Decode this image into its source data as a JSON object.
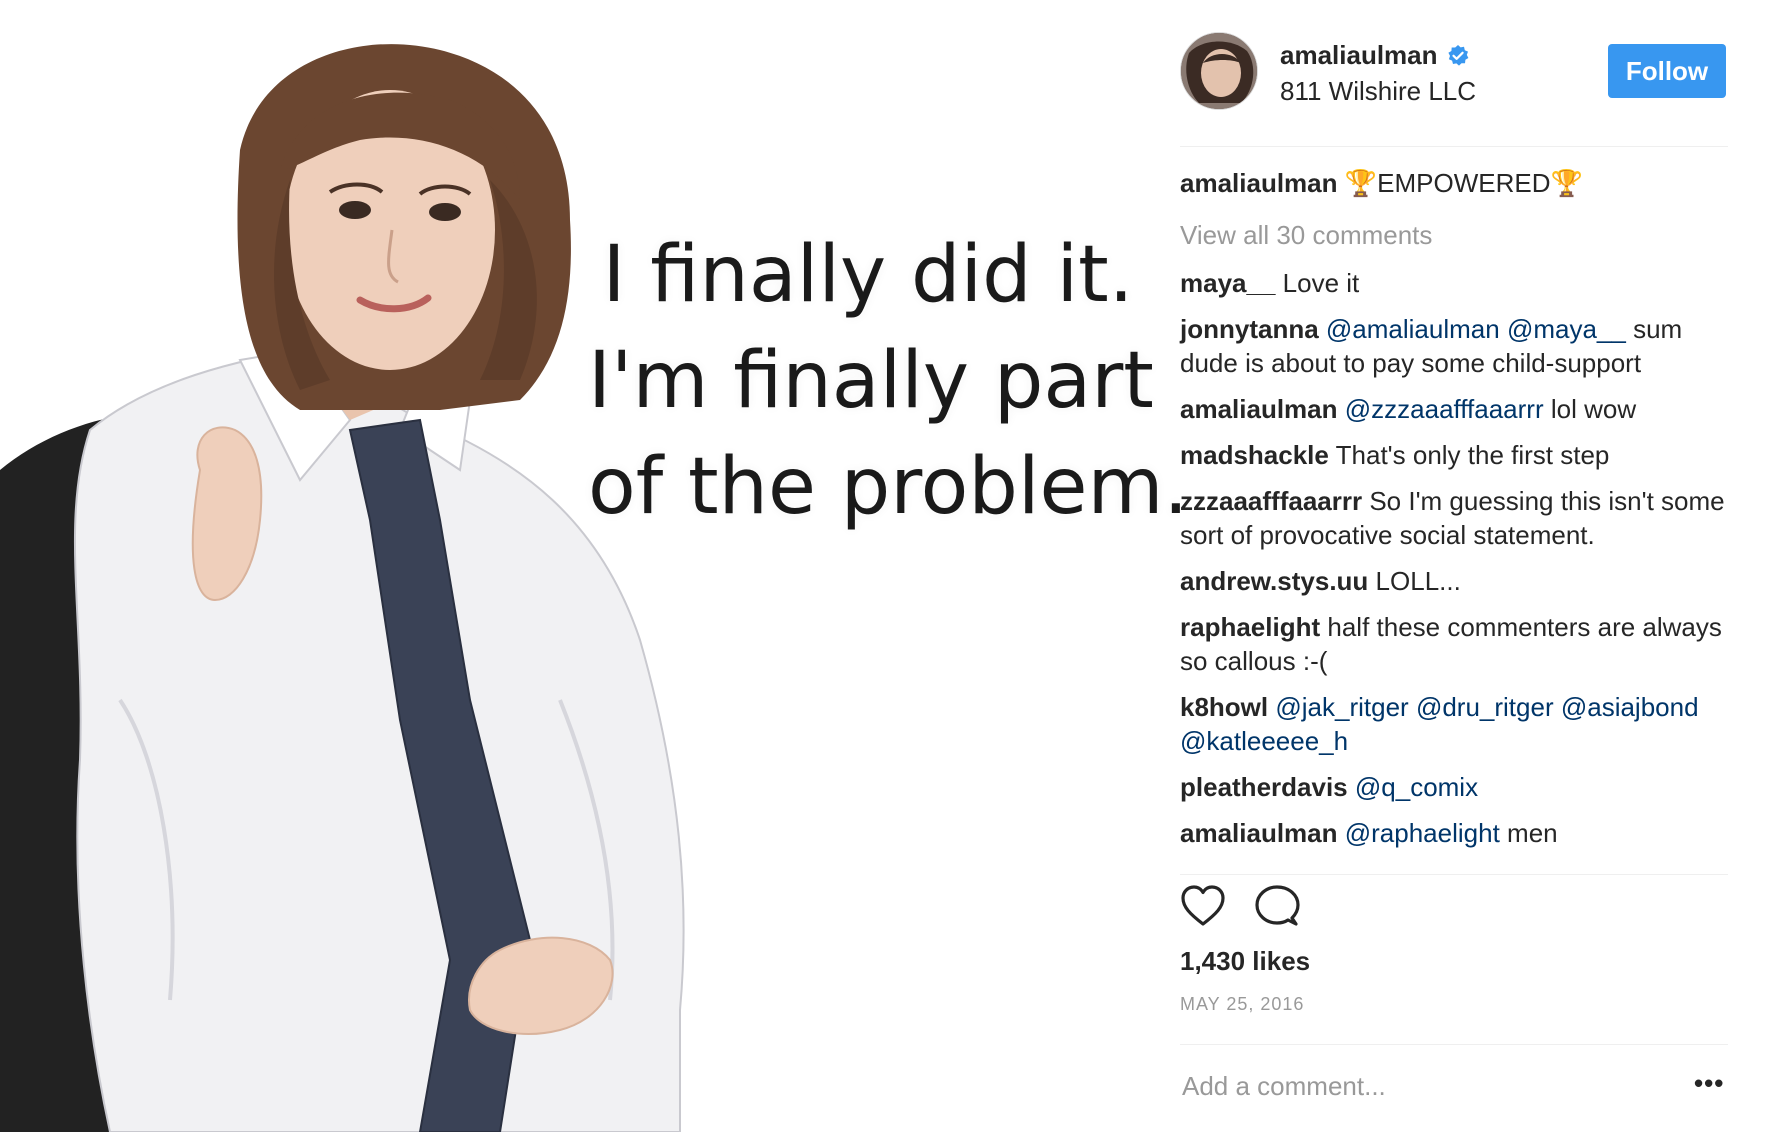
{
  "post": {
    "quote_lines": [
      "I finally did it.",
      "I'm finally part",
      "of the problem."
    ]
  },
  "header": {
    "username": "amaliaulman",
    "location": "811 Wilshire LLC",
    "follow_label": "Follow",
    "verified_icon": "verified-badge-icon"
  },
  "caption": {
    "username": "amaliaulman",
    "text": "🏆EMPOWERED🏆"
  },
  "view_all_comments": "View all 30 comments",
  "comments": [
    {
      "user": "maya__",
      "mentions": [],
      "text": "Love it"
    },
    {
      "user": "jonnytanna",
      "mentions": [
        "@amaliaulman",
        "@maya__"
      ],
      "text": "sum dude is about to pay some child-support"
    },
    {
      "user": "amaliaulman",
      "mentions": [
        "@zzzaaafffaaarrr"
      ],
      "text": "lol wow"
    },
    {
      "user": "madshackle",
      "mentions": [],
      "text": "That's only the first step"
    },
    {
      "user": "zzzaaafffaaarrr",
      "mentions": [],
      "text": "So I'm guessing this isn't some sort of provocative social statement."
    },
    {
      "user": "andrew.stys.uu",
      "mentions": [],
      "text": "LOLL..."
    },
    {
      "user": "raphaelight",
      "mentions": [],
      "text": "half these commenters are always so callous :-("
    },
    {
      "user": "k8howl",
      "mentions": [
        "@jak_ritger",
        "@dru_ritger",
        "@asiajbond",
        "@katleeeee_h"
      ],
      "text": ""
    },
    {
      "user": "pleatherdavis",
      "mentions": [
        "@q_comix"
      ],
      "text": ""
    },
    {
      "user": "amaliaulman",
      "mentions": [
        "@raphaelight"
      ],
      "text": "men"
    }
  ],
  "actions": {
    "like_icon": "heart-icon",
    "comment_icon": "comment-bubble-icon"
  },
  "likes": "1,430 likes",
  "date": "MAY 25, 2016",
  "add_comment_placeholder": "Add a comment...",
  "more_label": "•••",
  "colors": {
    "follow_bg": "#3897f0",
    "mention": "#003569",
    "muted": "#999999",
    "text": "#262626",
    "divider": "#efefef"
  }
}
